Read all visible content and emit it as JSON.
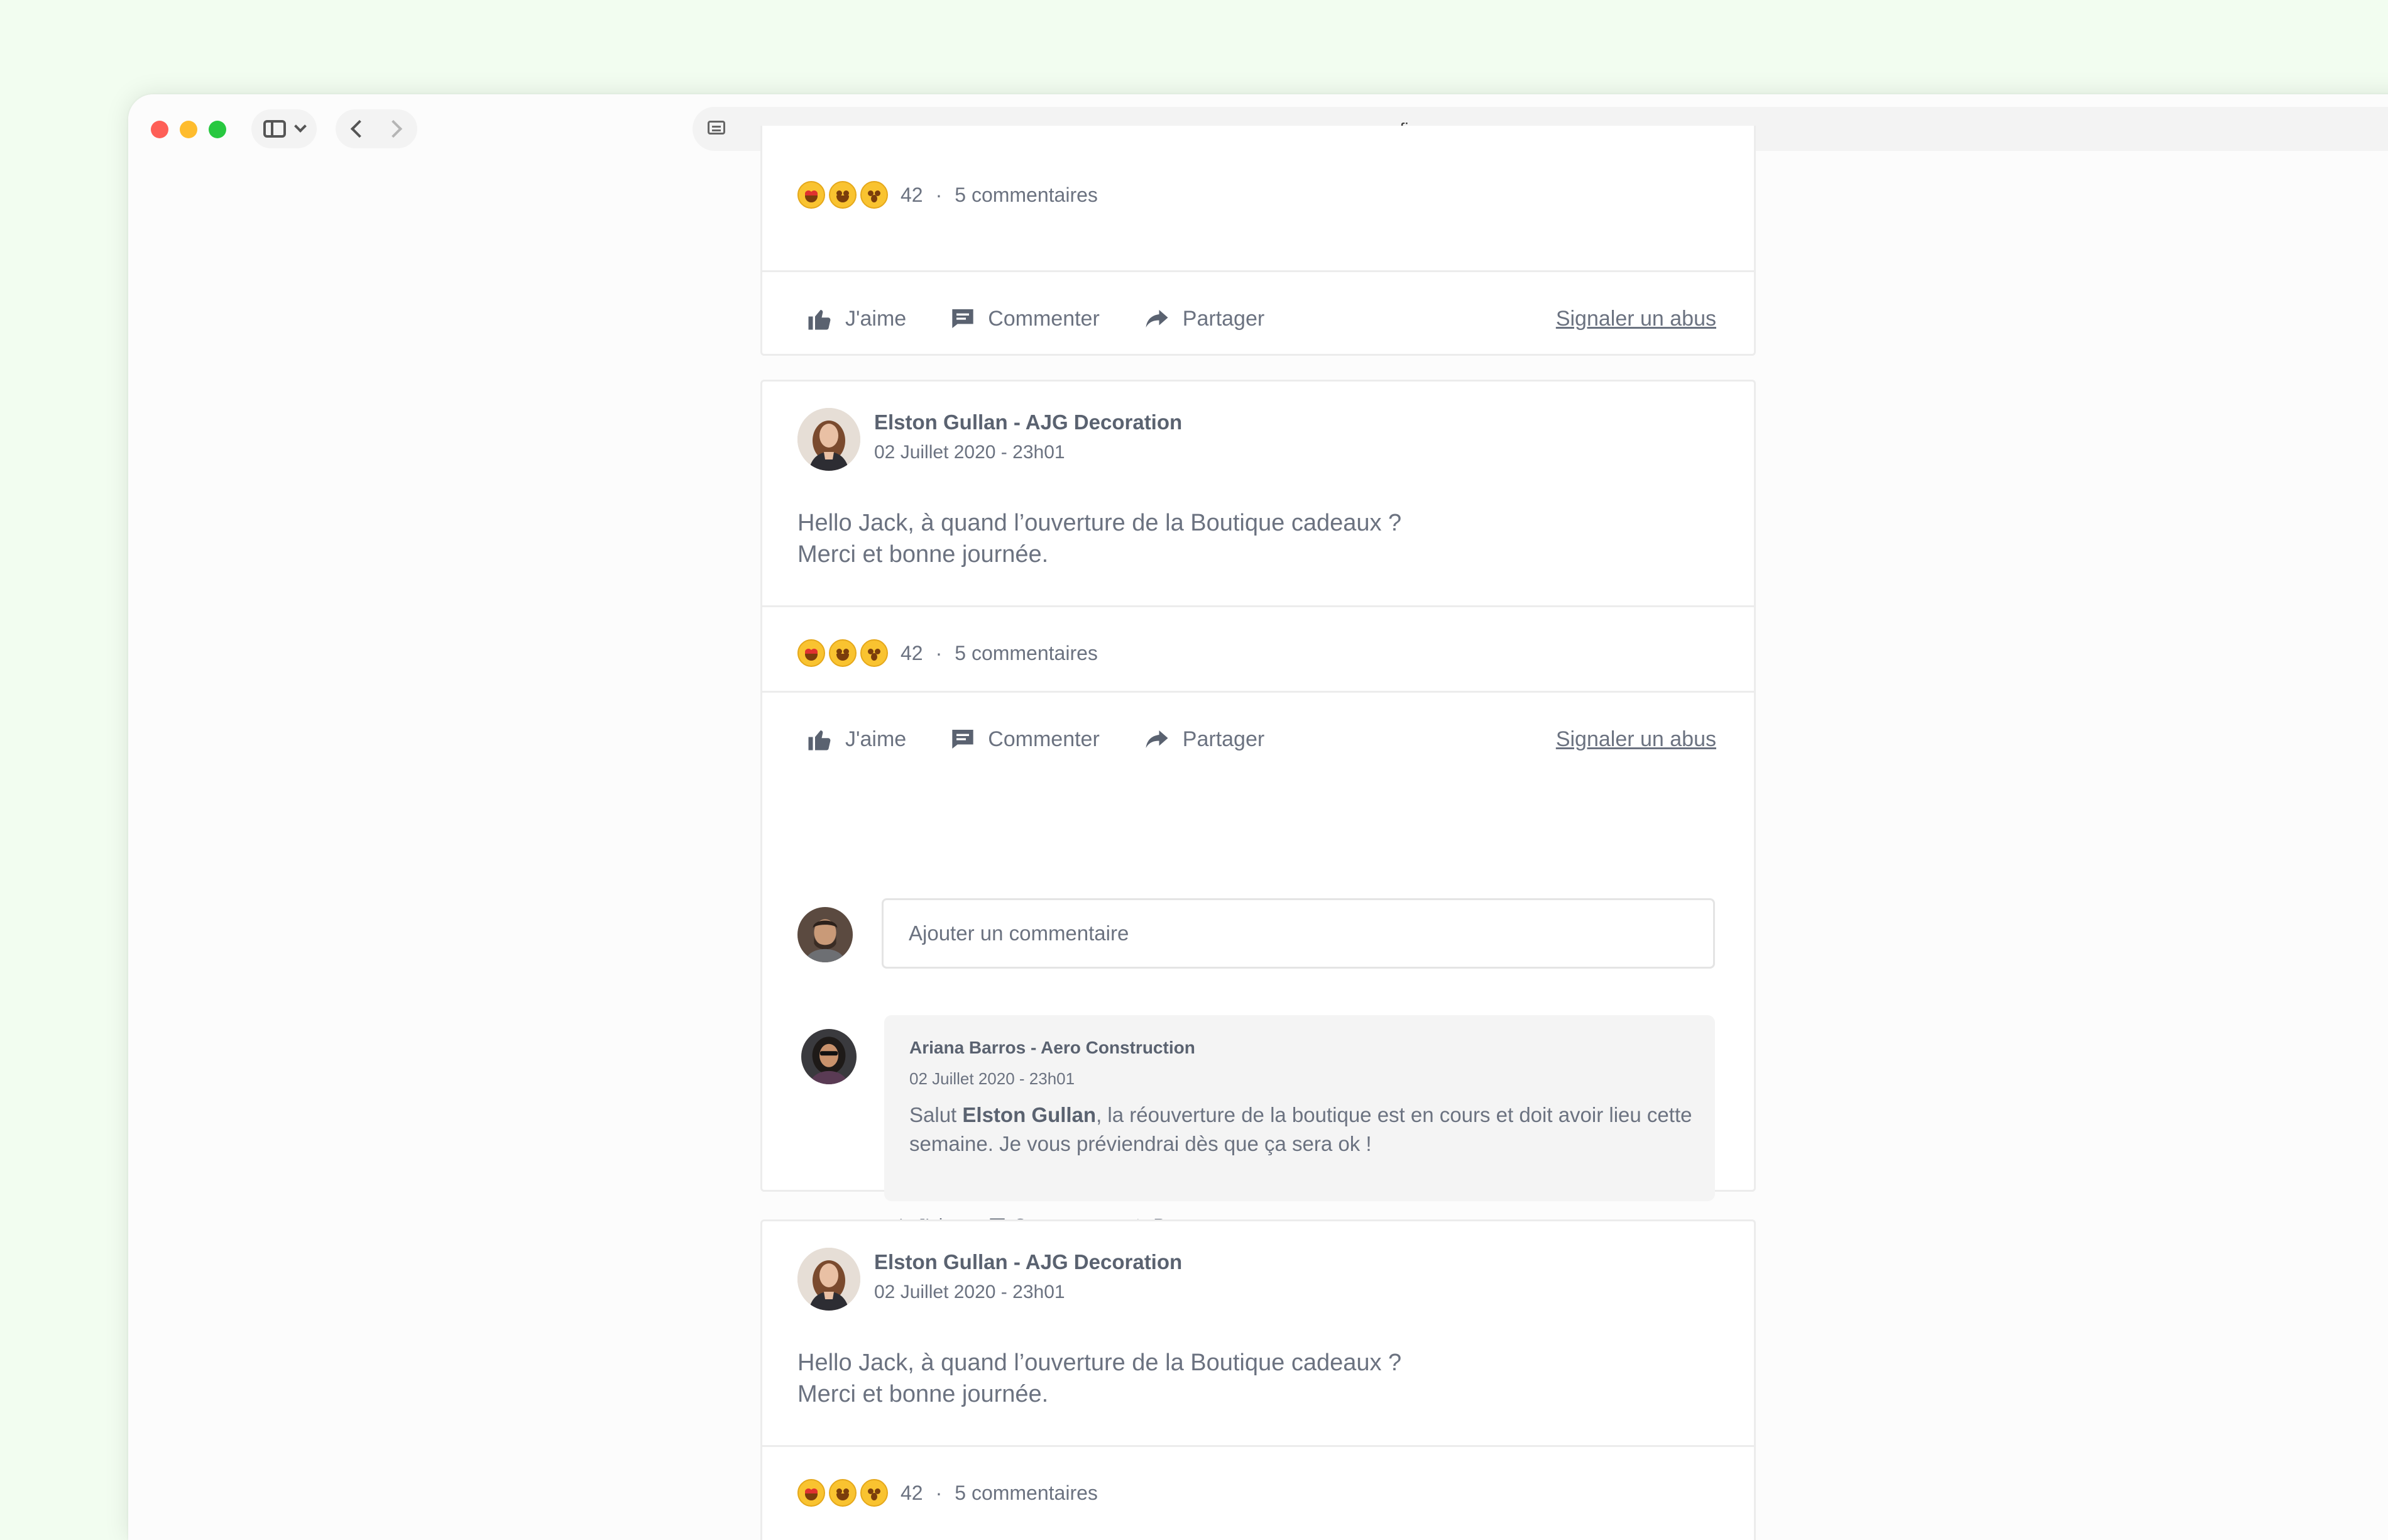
{
  "browser": {
    "url": "figma.com"
  },
  "actions": {
    "like": "J'aime",
    "comment": "Commenter",
    "share": "Partager",
    "report": "Signaler un abus"
  },
  "posts": [
    {
      "reaction_count": "42",
      "separator": "·",
      "comments_label": "5 commentaires"
    },
    {
      "author": "Elston Gullan - AJG Decoration",
      "date": "02 Juillet 2020 - 23h01",
      "text_line1": "Hello Jack, à quand l’ouverture de la Boutique cadeaux ?",
      "text_line2": "Merci et bonne journée.",
      "reaction_count": "42",
      "separator": "·",
      "comments_label": "5 commentaires",
      "comment_placeholder": "Ajouter un commentaire",
      "reply": {
        "author": "Ariana Barros - Aero Construction",
        "date": "02 Juillet 2020 - 23h01",
        "text_prefix": "Salut ",
        "mention": "Elston Gullan",
        "text_suffix": ", la réouverture de la boutique est en cours et doit avoir lieu cette semaine. Je vous préviendrai dès que ça sera ok !"
      }
    },
    {
      "author": "Elston Gullan - AJG Decoration",
      "date": "02 Juillet 2020 - 23h01",
      "text_line1": "Hello Jack, à quand l’ouverture de la Boutique cadeaux ?",
      "text_line2": "Merci et bonne journée.",
      "reaction_count": "42",
      "separator": "·",
      "comments_label": "5 commentaires"
    }
  ],
  "colors": {
    "desktop_bg": "#f2fdf0",
    "text": "#6b7280",
    "icon": "#5a6270"
  },
  "icons": [
    "sidebar-icon",
    "chevron-down-icon",
    "back-icon",
    "forward-icon",
    "site-icon",
    "thumbs-up-icon",
    "comment-icon",
    "share-icon",
    "heart-eyes-emoji",
    "laughing-emoji",
    "surprised-emoji"
  ]
}
